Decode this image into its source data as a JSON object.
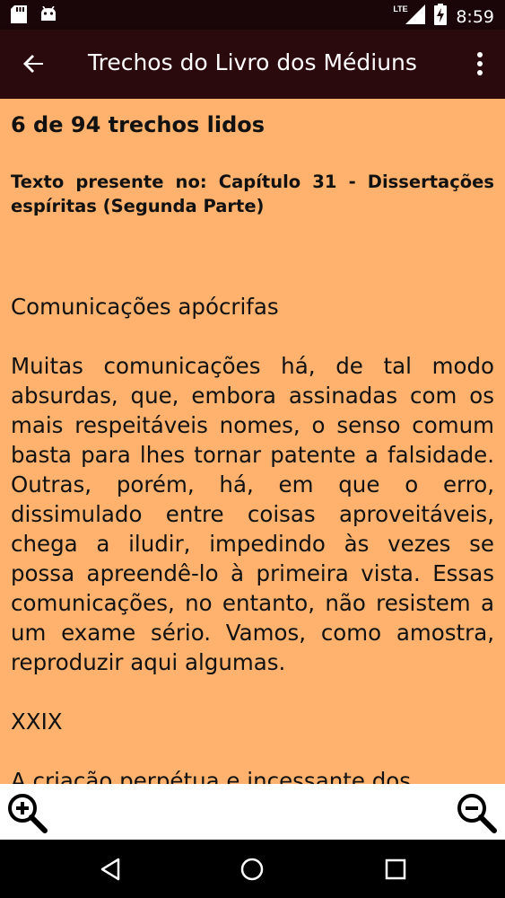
{
  "status_bar": {
    "time": "8:59",
    "network": "LTE",
    "icons": [
      "sd-card-icon",
      "android-icon",
      "signal-icon",
      "battery-charging-icon"
    ]
  },
  "app_bar": {
    "title": "Trechos do Livro dos Médiuns",
    "back_icon": "arrow-left-icon",
    "menu_icon": "more-vert-icon"
  },
  "content": {
    "progress": "6 de 94 trechos lidos",
    "chapter": "Texto presente no: Capítulo 31 - Dissertações espíritas (Segunda Parte)",
    "heading": "Comunicações apócrifas",
    "paragraph": "Muitas comunicações há, de tal modo absurdas, que, embora assinadas com os mais respeitáveis nomes, o senso comum basta para lhes tornar patente a falsidade. Outras, porém, há, em que o erro, dissimulado entre coisas aproveitáveis, chega a iludir, impedindo às vezes se possa apreendê-lo à primeira vista. Essas comunicações, no entanto, não resistem a um exame sério. Vamos, como amostra, reproduzir aqui algumas.",
    "section_number": "XXIX",
    "paragraph2": "A criação perpétua e incessante dos"
  },
  "zoom_bar": {
    "zoom_in_icon": "zoom-in-icon",
    "zoom_out_icon": "zoom-out-icon"
  },
  "nav_bar": {
    "icons": [
      "nav-back-icon",
      "nav-home-icon",
      "nav-recents-icon"
    ]
  },
  "colors": {
    "status_bar": "#1a0608",
    "app_bar": "#2b0a0e",
    "content_bg": "#ffb26e",
    "zoom_bar_bg": "#ffffff",
    "nav_bar": "#000000"
  }
}
